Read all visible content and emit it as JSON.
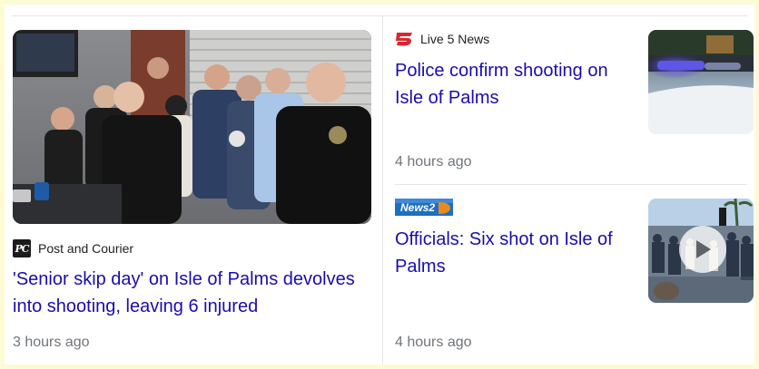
{
  "articles": [
    {
      "source": "Post and Courier",
      "source_logo_text": "PC",
      "headline": "'Senior skip day' on Isle of Palms devolves into shooting, leaving 6 injured",
      "time": "3 hours ago",
      "logo_color": "#1b1b1b"
    },
    {
      "source": "Live 5 News",
      "headline": "Police confirm shooting on Isle of Palms",
      "time": "4 hours ago",
      "logo_color": "#d7282f"
    },
    {
      "source_logo_text": "News2",
      "headline": "Officials: Six shot on Isle of Palms",
      "time": "4 hours ago",
      "has_video": true,
      "logo_color": "#1d6fc1"
    }
  ],
  "colors": {
    "link": "#1a0dab",
    "meta": "#70757a",
    "page_border": "#fdfbd3"
  }
}
